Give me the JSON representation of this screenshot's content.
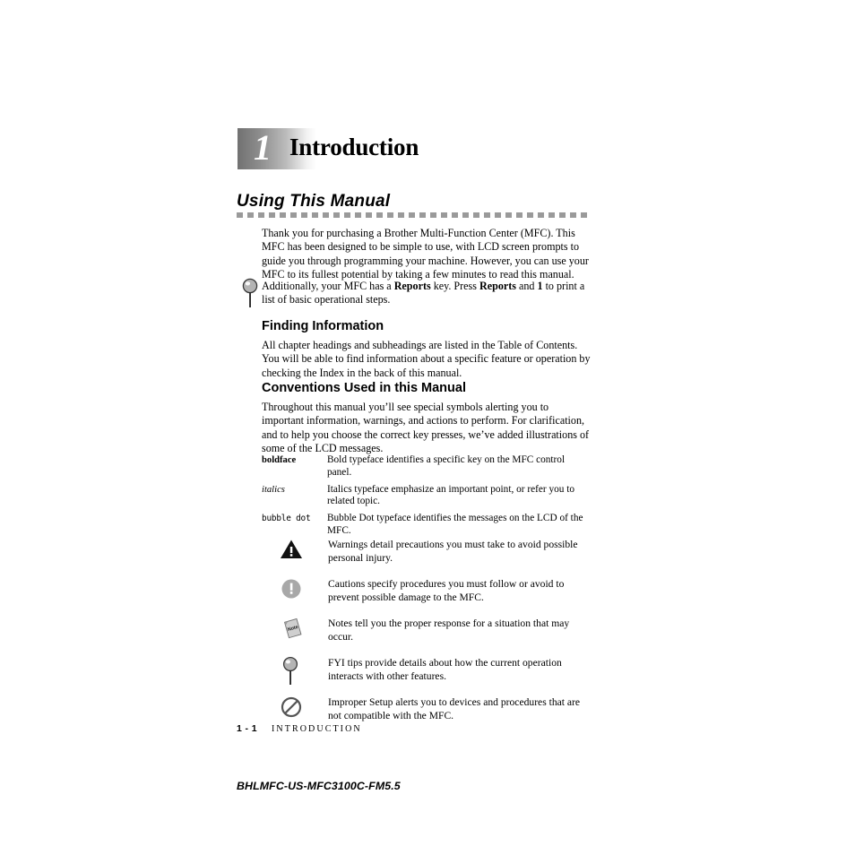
{
  "chapter": {
    "number": "1",
    "title": "Introduction"
  },
  "section": {
    "heading": "Using This Manual"
  },
  "paragraphs": {
    "intro": "Thank you for purchasing a Brother Multi-Function Center (MFC). This MFC has been designed to be simple to use, with LCD screen prompts to guide you through programming your machine. However, you can use your MFC to its fullest potential by taking a few minutes to read this manual.",
    "fyi_prefix": "Additionally, your MFC has a ",
    "fyi_bold1": "Reports",
    "fyi_mid1": " key. Press ",
    "fyi_bold2": "Reports",
    "fyi_mid2": " and ",
    "fyi_bold3": "1",
    "fyi_suffix": " to print a list of basic operational steps.",
    "finding": "All chapter headings and subheadings are listed in the Table of Contents. You will be able to find information about a specific feature or operation by checking the Index in the back of this manual.",
    "conventions": "Throughout this manual you’ll see special symbols alerting you to important information, warnings, and actions to perform. For clarification, and to help you choose the correct key presses, we’ve added illustrations of some of the LCD messages."
  },
  "subheadings": {
    "finding": "Finding Information",
    "conventions": "Conventions Used in this Manual"
  },
  "typeface_table": [
    {
      "term": "boldface",
      "style": "bold",
      "description": "Bold typeface identifies a specific key on the MFC control panel."
    },
    {
      "term": "italics",
      "style": "italic",
      "description": "Italics typeface emphasize an important point, or refer you to related topic."
    },
    {
      "term": "bubble dot",
      "style": "mono",
      "description": "Bubble Dot typeface identifies the messages on the LCD of the MFC."
    }
  ],
  "symbols": [
    {
      "icon": "warning-triangle-icon",
      "description": "Warnings detail precautions you must take to avoid possible personal injury."
    },
    {
      "icon": "caution-circle-icon",
      "description": "Cautions specify procedures you must follow or avoid to prevent possible damage to the MFC."
    },
    {
      "icon": "note-page-icon",
      "label": "Note",
      "description": "Notes tell you the proper response for a situation that may occur."
    },
    {
      "icon": "fyi-pin-icon",
      "description": "FYI tips provide details about how the current operation interacts with other features."
    },
    {
      "icon": "improper-setup-icon",
      "description": "Improper Setup alerts you to devices and procedures that are not compatible with the MFC."
    }
  ],
  "footer": {
    "page_number": "1 - 1",
    "chapter_name": "INTRODUCTION",
    "document_code": "BHLMFC-US-MFC3100C-FM5.5"
  },
  "colors": {
    "text": "#000000",
    "rule_gray": "#9a9a9a",
    "icon_gray": "#9d9d9d",
    "icon_dark": "#4a4a4a"
  }
}
